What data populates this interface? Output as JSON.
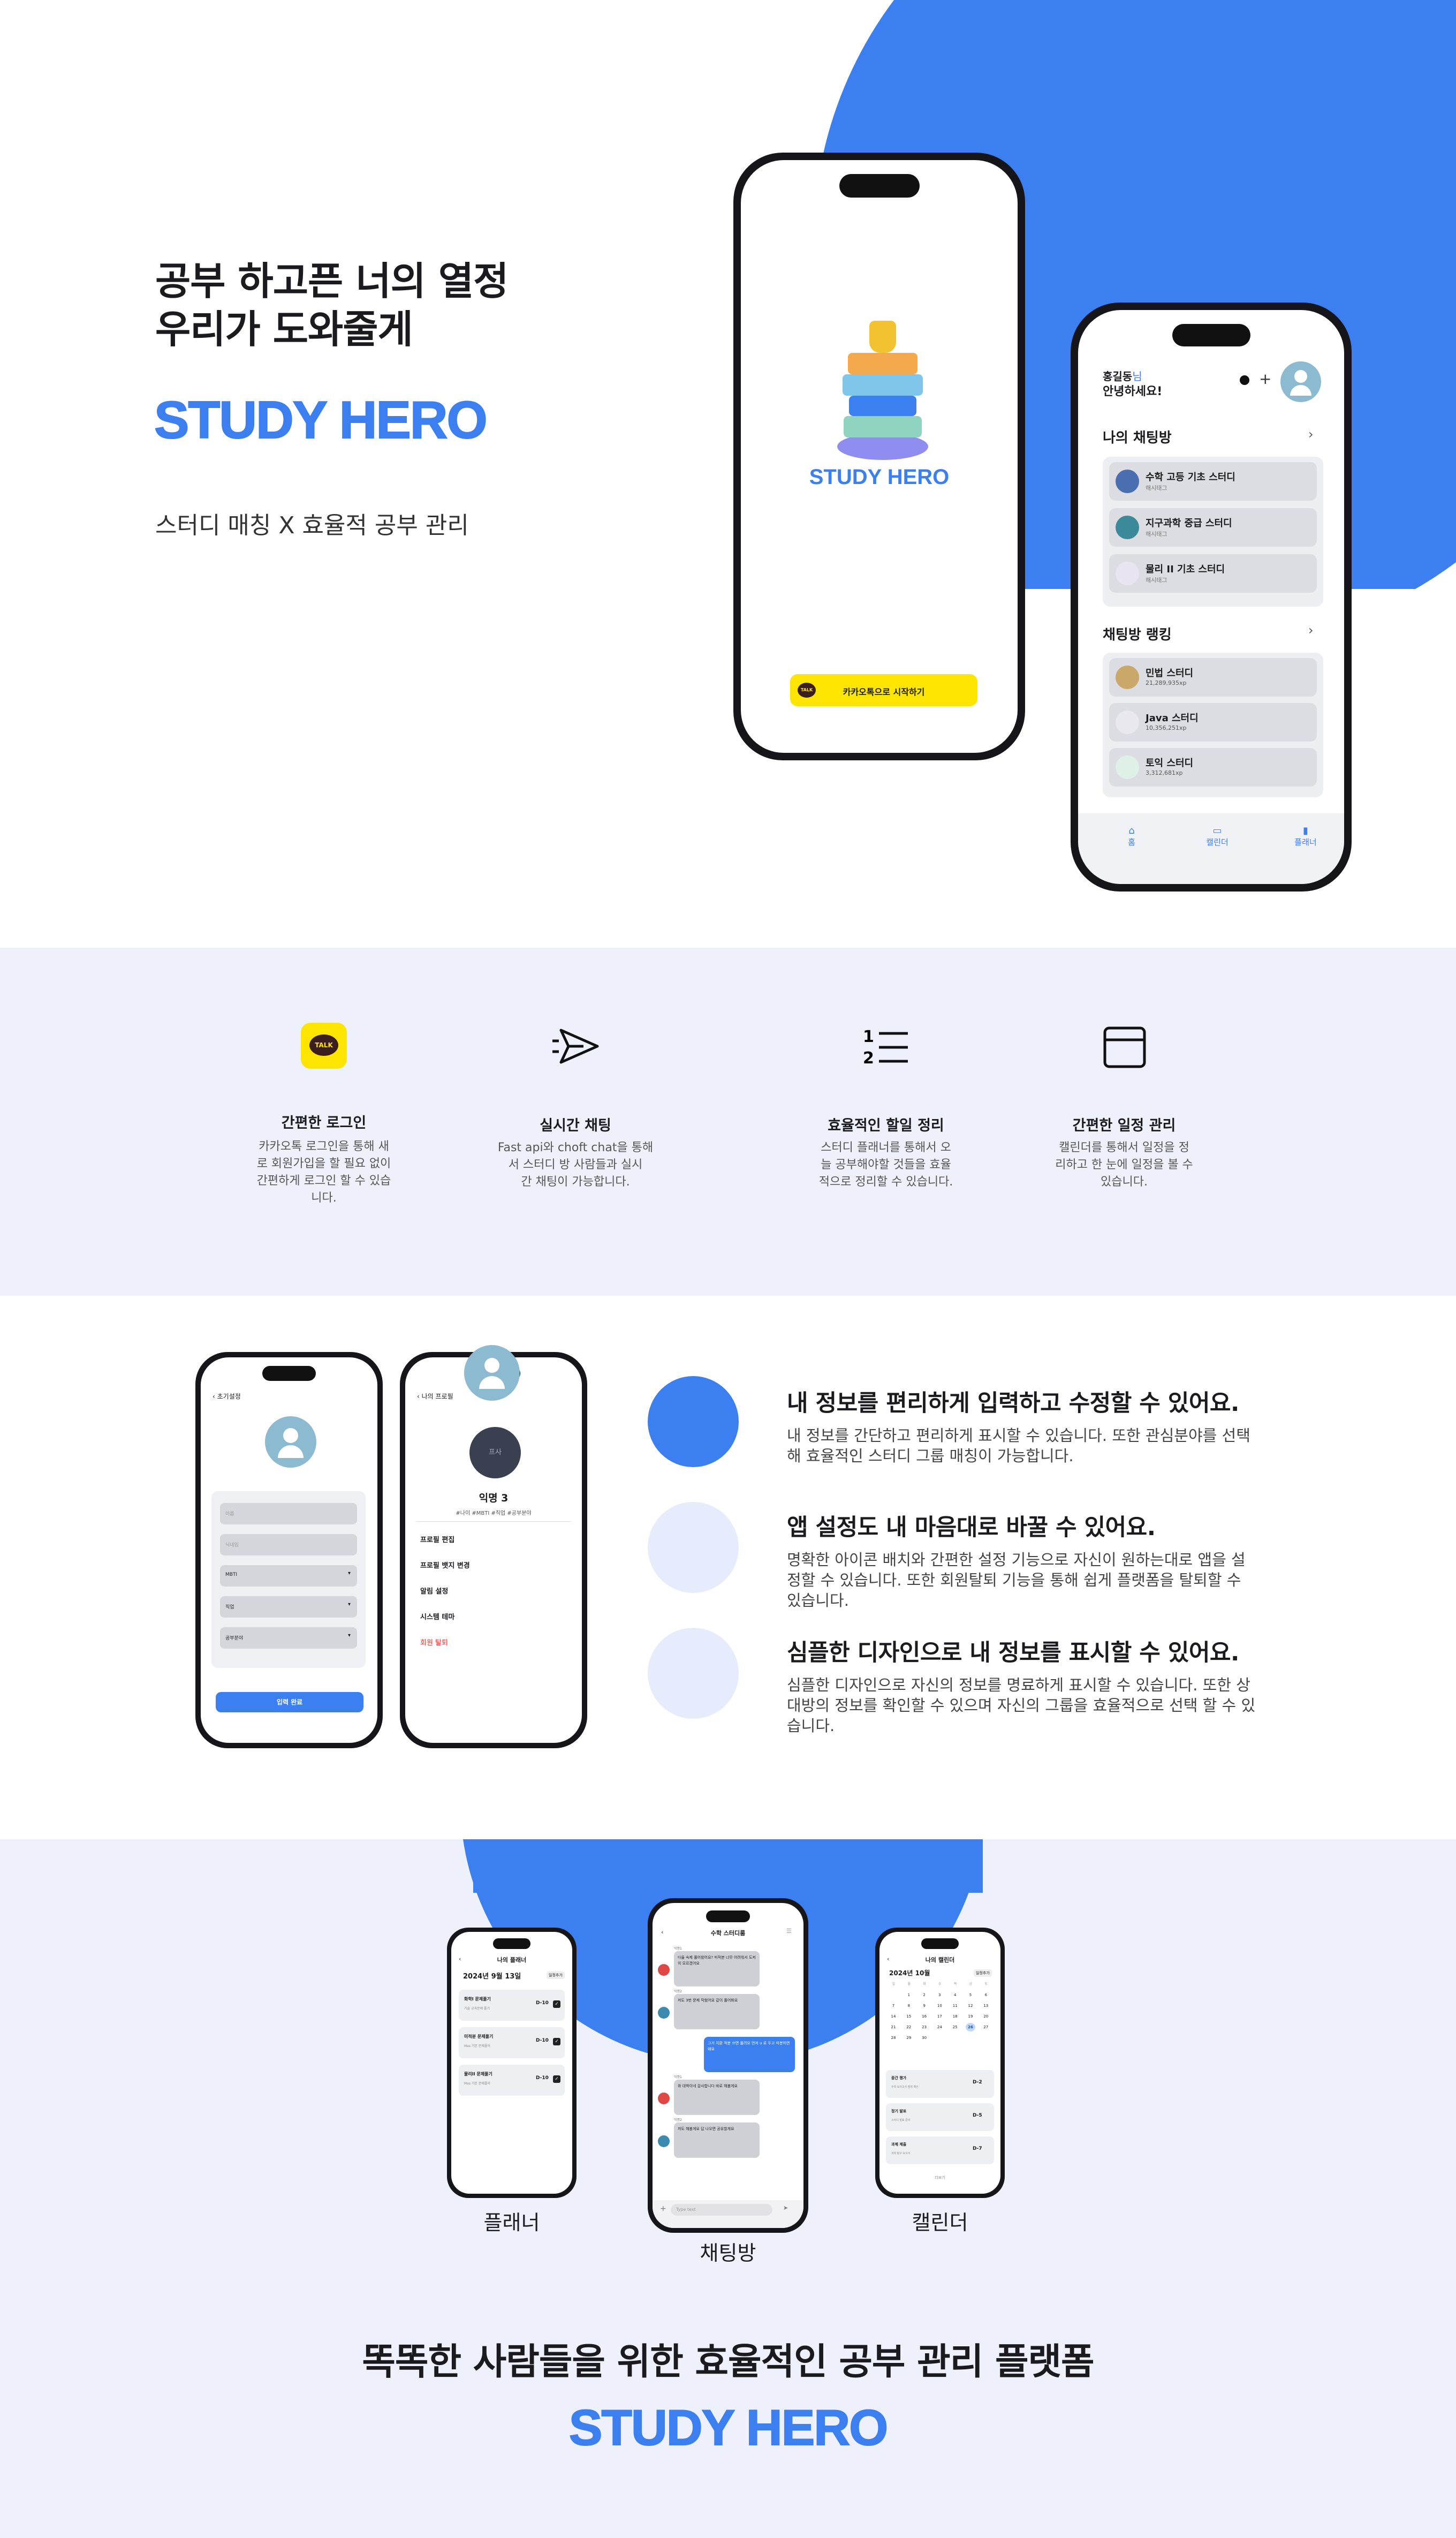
{
  "colors": {
    "accent": "#3c7ff0",
    "light_bg": "#eef1fc",
    "kakao": "#fee500"
  },
  "hero": {
    "headline": [
      "공부 하고픈 너의 열정",
      "우리가 도와줄게"
    ],
    "brand": "STUDY HERO",
    "subtitle": "스터디 매칭 X 효율적 공부 관리"
  },
  "splash": {
    "brand": "STUDY HERO",
    "kakao_button": "카카오톡으로 시작하기",
    "kakao_badge": "TALK"
  },
  "home": {
    "user_name": "홍길동",
    "user_suffix": "님",
    "greeting": "안녕하세요!",
    "my_chat_title": "나의 채팅방",
    "my_chats": [
      {
        "name": "수학 고등 기초 스터디",
        "sub": "해시태그"
      },
      {
        "name": "지구과학 중급 스터디",
        "sub": "해시태그"
      },
      {
        "name": "물리 II 기초 스터디",
        "sub": "해시태그"
      }
    ],
    "ranking_title": "채팅방 랭킹",
    "ranking": [
      {
        "name": "민법 스터디",
        "sub": "21,289,935xp"
      },
      {
        "name": "Java 스터디",
        "sub": "10,356,251xp"
      },
      {
        "name": "토익 스터디",
        "sub": "3,312,681xp"
      }
    ],
    "tabs": [
      "홈",
      "캘린더",
      "플래너"
    ]
  },
  "features": [
    {
      "icon": "kakao-talk-icon",
      "title": "간편한 로그인",
      "desc": [
        "카카오톡 로그인을 통해 새",
        "로 회원가입을 할 필요 없이",
        "간편하게 로그인 할 수 있습",
        "니다."
      ]
    },
    {
      "icon": "send-icon",
      "title": "실시간 채팅",
      "desc": [
        "Fast api와 choft chat을 통해",
        "서 스터디 방 사람들과 실시",
        "간 채팅이 가능합니다."
      ]
    },
    {
      "icon": "numbered-list-icon",
      "title": "효율적인 할일 정리",
      "desc": [
        "스터디 플래너를 통해서 오",
        "늘 공부해야할 것들을 효율",
        "적으로 정리할 수 있습니다."
      ]
    },
    {
      "icon": "calendar-icon",
      "title": "간편한 일정 관리",
      "desc": [
        "캘린더를 통해서 일정을 정",
        "리하고 한 눈에 일정을 볼 수",
        "있습니다."
      ]
    }
  ],
  "profile_edit": {
    "back": "초기설정",
    "fields": [
      "이름",
      "닉네임",
      "MBTI",
      "직업",
      "공부분야"
    ],
    "submit": "입력 완료"
  },
  "my_profile": {
    "back": "나의 프로필",
    "avatar_text": "프사",
    "name": "익명 3",
    "tags": "#나이 #MBTI #직업 #공부분야",
    "menu": [
      "프로필 편집",
      "프로필 뱃지 변경",
      "알림 설정",
      "시스템 테마"
    ],
    "danger": "회원 탈퇴"
  },
  "mid_features": [
    {
      "title": "내 정보를 편리하게 입력하고 수정할 수 있어요.",
      "desc": [
        "내 정보를 간단하고 편리하게 표시할 수 있습니다. 또한 관심분야를 선택",
        "해 효율적인 스터디 그룹 매칭이 가능합니다."
      ]
    },
    {
      "title": "앱 설정도 내 마음대로 바꿀 수 있어요.",
      "desc": [
        "명확한 아이콘 배치와 간편한 설정 기능으로 자신이 원하는대로 앱을 설",
        "정할 수 있습니다.  또한 회원탈퇴 기능을 통해 쉽게 플랫폼을 탈퇴할 수",
        "있습니다."
      ]
    },
    {
      "title": "심플한 디자인으로 내 정보를 표시할 수 있어요.",
      "desc": [
        "심플한 디자인으로 자신의 정보를 명료하게 표시할 수 있습니다. 또한 상",
        "대방의 정보를 확인할 수 있으며 자신의 그룹을 효율적으로 선택 할 수 있",
        "습니다."
      ]
    }
  ],
  "planner": {
    "title": "나의 플래너",
    "date": "2024년 9월 13일",
    "btn": "일정추가",
    "items": [
      {
        "name": "화학I 문제풀기",
        "sub": "기술 교과문제 풀기",
        "dday": "D-10"
      },
      {
        "name": "미적분 문제풀기",
        "sub": "Mas 기본 문제풀이",
        "dday": "D-10"
      },
      {
        "name": "물리II 문제풀기",
        "sub": "Mas 기본 문제풀이",
        "dday": "D-10"
      }
    ],
    "label": "플래너"
  },
  "chat": {
    "title": "수학 스터디룸",
    "messages": [
      {
        "side": "left",
        "who": "익명1",
        "text": "다들 숙제 풀어왔어요? 미적분 너무 어려워서 도저히 모르겠어요"
      },
      {
        "side": "left",
        "who": "익명2",
        "text": "저도 3번 문제 막혔어요 같이 풀어봐요"
      },
      {
        "side": "right",
        "who": "",
        "text": "그거 치환 적분 쓰면 풀려요 먼저 u 로 두고 미분하면 돼요"
      },
      {
        "side": "left",
        "who": "익명1",
        "text": "와 대박이네 감사합니다 바로 해볼게요"
      },
      {
        "side": "left",
        "who": "익명2",
        "text": "저도 해볼게요 답 나오면 공유할게요"
      }
    ],
    "input_placeholder": "Type text",
    "label": "채팅방"
  },
  "calendar": {
    "title": "나의 캘린더",
    "month": "2024년 10월",
    "btn": "일정추가",
    "weekdays": [
      "일",
      "월",
      "화",
      "수",
      "목",
      "금",
      "토"
    ],
    "days": [
      "",
      "1",
      "2",
      "3",
      "4",
      "5",
      "6",
      "7",
      "8",
      "9",
      "10",
      "11",
      "12",
      "13",
      "14",
      "15",
      "16",
      "17",
      "18",
      "19",
      "20",
      "21",
      "22",
      "23",
      "24",
      "25",
      "26",
      "27",
      "28",
      "29",
      "30"
    ],
    "today": "26",
    "events": [
      {
        "name": "중간 평가",
        "sub": "수학 모의고사 범위 확인",
        "dday": "D-2"
      },
      {
        "name": "정기 발표",
        "sub": "스터디 발표 준비",
        "dday": "D-5"
      },
      {
        "name": "과제 제출",
        "sub": "과학 탐구 보고서",
        "dday": "D-7"
      }
    ],
    "more": "더보기",
    "label": "캘린더"
  },
  "footer": {
    "tagline": "똑똑한 사람들을 위한 효율적인 공부 관리 플랫폼",
    "brand": "STUDY HERO"
  }
}
